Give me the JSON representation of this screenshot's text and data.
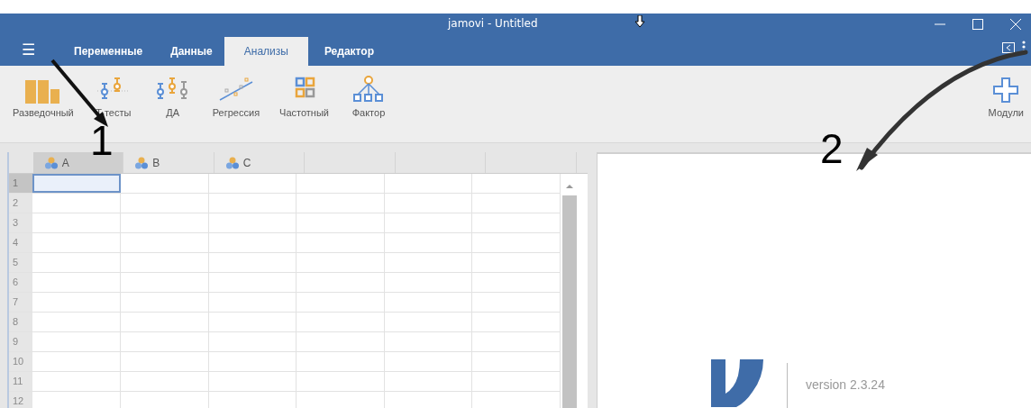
{
  "window": {
    "title": "jamovi - Untitled"
  },
  "menu_icon": "☰",
  "tabs": [
    {
      "label": "Переменные",
      "selected": false
    },
    {
      "label": "Данные",
      "selected": false
    },
    {
      "label": "Анализы",
      "selected": true
    },
    {
      "label": "Редактор",
      "selected": false
    }
  ],
  "toolbar": [
    {
      "kind": "exploration",
      "label": "Разведочный"
    },
    {
      "kind": "ttest",
      "label": "T-тесты"
    },
    {
      "kind": "anova",
      "label": "ДА"
    },
    {
      "kind": "regression",
      "label": "Регрессия"
    },
    {
      "kind": "frequency",
      "label": "Частотный"
    },
    {
      "kind": "factor",
      "label": "Фактор"
    }
  ],
  "modules": {
    "label": "Модули"
  },
  "columns": [
    {
      "name": "A",
      "selected": true
    },
    {
      "name": "B",
      "selected": false
    },
    {
      "name": "C",
      "selected": false
    }
  ],
  "rows": [
    {
      "label": "1",
      "selected": true
    },
    {
      "label": "2",
      "selected": false
    },
    {
      "label": "3",
      "selected": false
    },
    {
      "label": "4",
      "selected": false
    },
    {
      "label": "5",
      "selected": false
    },
    {
      "label": "6",
      "selected": false
    },
    {
      "label": "7",
      "selected": false
    },
    {
      "label": "8",
      "selected": false
    },
    {
      "label": "9",
      "selected": false
    },
    {
      "label": "10",
      "selected": false
    },
    {
      "label": "11",
      "selected": false
    },
    {
      "label": "12",
      "selected": false
    }
  ],
  "results": {
    "version": "version 2.3.24"
  },
  "annotations": [
    {
      "label": "1"
    },
    {
      "label": "2"
    }
  ]
}
